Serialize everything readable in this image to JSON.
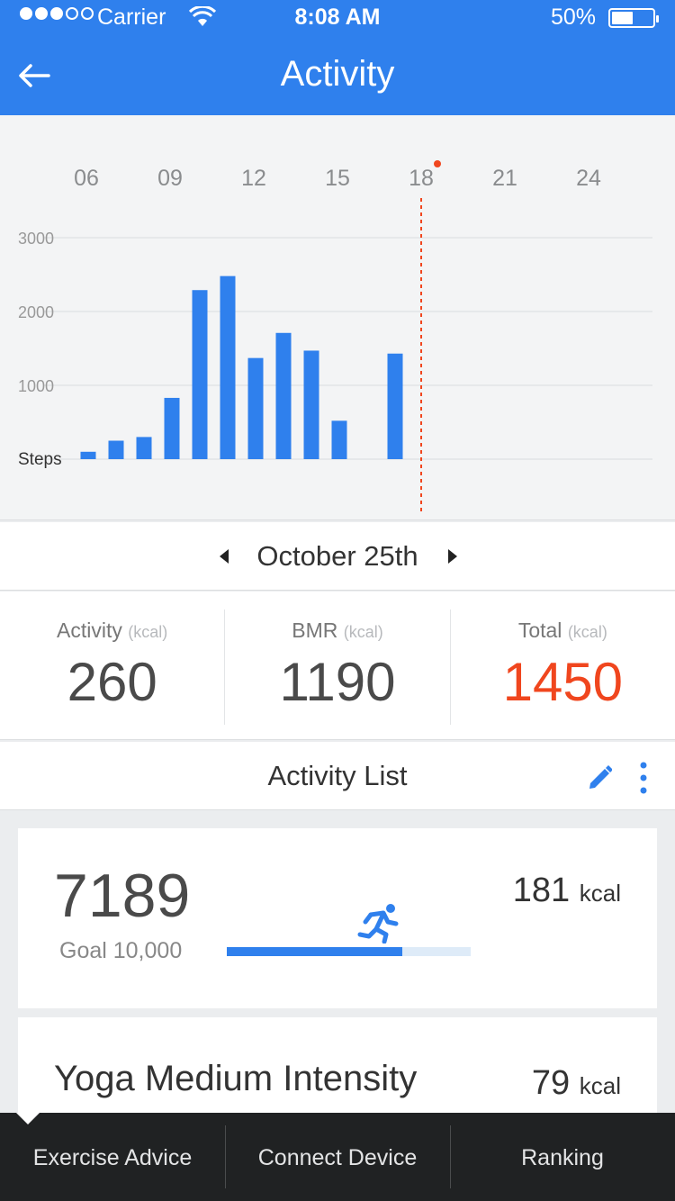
{
  "status_bar": {
    "carrier": "Carrier",
    "time": "8:08 AM",
    "battery_percent": "50%",
    "battery_level": 0.5,
    "signal_filled": 3,
    "signal_total": 5
  },
  "header": {
    "title": "Activity"
  },
  "chart_data": {
    "type": "bar",
    "x_ticks": [
      "06",
      "09",
      "12",
      "15",
      "18",
      "21",
      "24"
    ],
    "y_ticks": [
      "3000",
      "2000",
      "1000"
    ],
    "ylabel": "Steps",
    "ylim": [
      0,
      3000
    ],
    "hours": [
      7,
      8,
      9,
      10,
      11,
      12,
      13,
      14,
      15,
      16,
      17,
      18
    ],
    "values": [
      100,
      250,
      300,
      830,
      2290,
      2480,
      1370,
      1710,
      1470,
      520,
      1430
    ],
    "bar_hours": [
      7,
      8,
      9,
      10,
      11,
      12,
      13,
      14,
      15,
      16,
      18
    ],
    "current_hour": 18,
    "grid": true,
    "colors": {
      "bar": "#2f80ed",
      "marker": "#f0461e"
    }
  },
  "date_nav": {
    "date": "October 25th"
  },
  "stats": [
    {
      "label": "Activity",
      "unit": "(kcal)",
      "value": "260"
    },
    {
      "label": "BMR",
      "unit": "(kcal)",
      "value": "1190"
    },
    {
      "label": "Total",
      "unit": "(kcal)",
      "value": "1450"
    }
  ],
  "list": {
    "title": "Activity List",
    "steps_card": {
      "steps": "7189",
      "goal": "Goal 10,000",
      "progress": 0.7189,
      "kcal": "181",
      "kcal_unit": "kcal"
    },
    "yoga_card": {
      "name": "Yoga Medium Intensity",
      "kcal": "79",
      "kcal_unit": "kcal"
    }
  },
  "tabs": [
    {
      "label": "Exercise Advice"
    },
    {
      "label": "Connect Device"
    },
    {
      "label": "Ranking"
    }
  ],
  "colors": {
    "primary": "#2f80ed",
    "accent": "#f0461e",
    "tabbar": "#202223"
  }
}
